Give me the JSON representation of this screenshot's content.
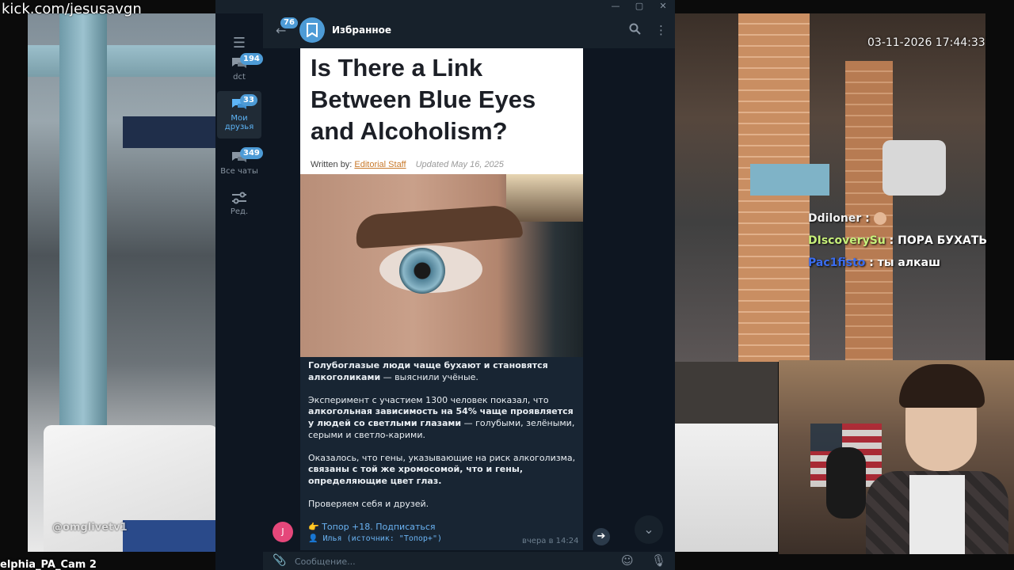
{
  "overlay": {
    "kick_url": "kick.com/jesusavgn",
    "timestamp": "03-11-2026 17:44:33",
    "left_watermark": "@omglivetv1",
    "cam_caption": "elphia_PA_Cam 2"
  },
  "stream_chat": [
    {
      "user": "Ddiloner",
      "sep": " : ",
      "text": "",
      "color": "#f1f1f1",
      "emote": true
    },
    {
      "user": "DIscoverySu",
      "sep": " : ",
      "text": "ПОРА БУХАТЬ",
      "color": "#c7f07a",
      "emote": false
    },
    {
      "user": "Pac1fisto",
      "sep": " : ",
      "text": "ты алкаш",
      "color": "#3a6df0",
      "emote": false
    }
  ],
  "telegram": {
    "window_controls": {
      "minimize": "—",
      "maximize": "▢",
      "close": "✕"
    },
    "menu_icon": "☰",
    "folders": [
      {
        "label": "dct",
        "badge": "194",
        "icon": "chat-bubbles-icon",
        "active": false
      },
      {
        "label": "Мои друзья",
        "badge": "33",
        "icon": "chat-bubbles-icon",
        "active": true
      },
      {
        "label": "Все чаты",
        "badge": "349",
        "icon": "chat-bubbles-icon",
        "active": false
      },
      {
        "label": "Ред.",
        "badge": "",
        "icon": "sliders-icon",
        "active": false
      }
    ],
    "header": {
      "back_badge": "76",
      "title": "Избранное",
      "search_icon": "search-icon",
      "more_icon": "more-vertical-icon"
    },
    "post": {
      "article_title": "Is There a Link Between Blue Eyes and Alcoholism?",
      "byline_prefix": "Written by:",
      "byline_author": "Editorial Staff",
      "byline_date": "Updated May 16, 2025",
      "p1_bold": "Голубоглазые люди чаще бухают и становятся алкоголиками",
      "p1_rest": " — выяснили учёные.",
      "p2_start": "Эксперимент с участием 1300 человек показал, что ",
      "p2_bold": "алкогольная зависимость на 54% чаще проявляется у людей со светлыми глазами",
      "p2_rest": " — голубыми, зелёными, серыми и светло-карими.",
      "p3_start": "Оказалось, что гены, указывающие на риск алкоголизма, ",
      "p3_bold": "связаны с той же хромосомой, что и гены, определяющие цвет глаз.",
      "p4": "Проверяем себя и друзей.",
      "link": "👉 Топор +18. Подписаться",
      "signature": "👤 Илья (источник: \"Топор+\")",
      "time": "вчера в 14:24",
      "sender_initial": "J"
    },
    "composer_placeholder": "Сообщение..."
  }
}
